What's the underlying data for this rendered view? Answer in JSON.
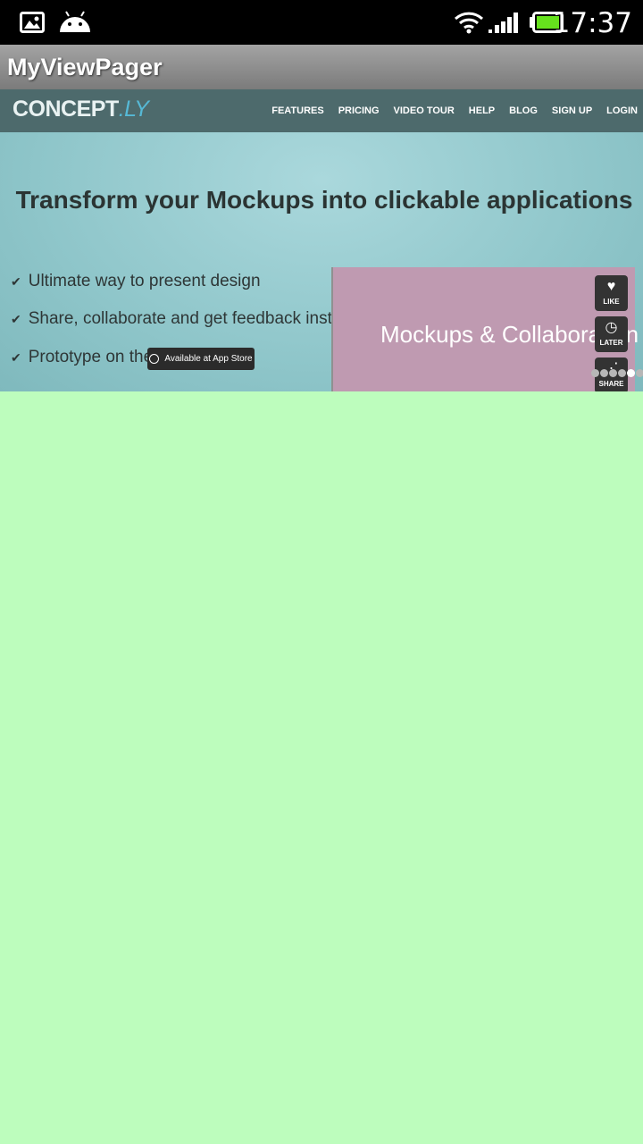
{
  "status_bar": {
    "time": "17:37",
    "icons": [
      "gallery-icon",
      "android-icon",
      "wifi-icon",
      "signal-icon",
      "battery-icon"
    ]
  },
  "action_bar": {
    "title": "MyViewPager"
  },
  "page": {
    "site_nav": {
      "logo": "CONCEPT",
      "logo_suffix": ".LY",
      "links": [
        "FEATURES",
        "PRICING",
        "VIDEO TOUR",
        "HELP",
        "BLOG",
        "SIGN UP",
        "LOGIN"
      ]
    },
    "headline": "Transform your Mockups into clickable applications",
    "bullets": [
      "Ultimate way to present design",
      "Share, collaborate and get feedback instantly.",
      "Prototype on the go"
    ],
    "app_store_label": "Available at App Store",
    "panel_text": "Mockups & Collaboration",
    "side_buttons": [
      "LIKE",
      "LATER",
      "SHARE"
    ],
    "pager": {
      "pages": 6,
      "active_index": 5
    }
  },
  "colors": {
    "background": "#bdfdbd",
    "status_bar": "#000000",
    "action_bar": "#8f8f8f",
    "site_nav": "#4d6a6c",
    "panel": "#bf9ab1"
  }
}
